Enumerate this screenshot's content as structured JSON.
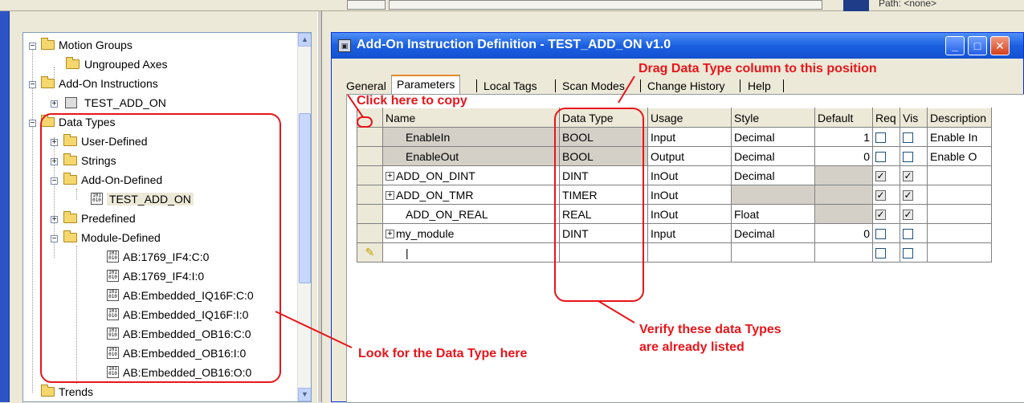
{
  "topbar": {
    "path_label": "Path:  <none>"
  },
  "tree": {
    "nodes": [
      "Motion Groups",
      "Ungrouped Axes",
      "Add-On Instructions",
      "TEST_ADD_ON",
      "Data Types",
      "User-Defined",
      "Strings",
      "Add-On-Defined",
      "TEST_ADD_ON",
      "Predefined",
      "Module-Defined",
      "AB:1769_IF4:C:0",
      "AB:1769_IF4:I:0",
      "AB:Embedded_IQ16F:C:0",
      "AB:Embedded_IQ16F:I:0",
      "AB:Embedded_OB16:C:0",
      "AB:Embedded_OB16:I:0",
      "AB:Embedded_OB16:O:0",
      "Trends"
    ]
  },
  "dialog": {
    "title": "Add-On Instruction Definition - TEST_ADD_ON v1.0",
    "tabs": [
      "General",
      "Parameters",
      "Local Tags",
      "Scan Modes",
      "Change History",
      "Help"
    ],
    "columns": [
      "Name",
      "Data Type",
      "Usage",
      "Style",
      "Default",
      "Req",
      "Vis",
      "Description"
    ],
    "rows": [
      {
        "name": "EnableIn",
        "type": "BOOL",
        "usage": "Input",
        "style": "Decimal",
        "default": "1",
        "desc": "Enable In"
      },
      {
        "name": "EnableOut",
        "type": "BOOL",
        "usage": "Output",
        "style": "Decimal",
        "default": "0",
        "desc": "Enable O"
      },
      {
        "name": "ADD_ON_DINT",
        "type": "DINT",
        "usage": "InOut",
        "style": "Decimal",
        "default": "",
        "desc": ""
      },
      {
        "name": "ADD_ON_TMR",
        "type": "TIMER",
        "usage": "InOut",
        "style": "",
        "default": "",
        "desc": ""
      },
      {
        "name": "ADD_ON_REAL",
        "type": "REAL",
        "usage": "InOut",
        "style": "Float",
        "default": "",
        "desc": ""
      },
      {
        "name": "my_module",
        "type": "DINT",
        "usage": "Input",
        "style": "Decimal",
        "default": "0",
        "desc": ""
      }
    ],
    "new_row_value": "|"
  },
  "annotations": {
    "drag": "Drag Data Type column to this position",
    "copy": "Click here to copy",
    "look": "Look for the Data Type here",
    "verify_1": "Verify these data Types",
    "verify_2": "are already listed"
  },
  "colors": {
    "annotation": "#e8151b",
    "titlebar": "#1a5fe0"
  }
}
